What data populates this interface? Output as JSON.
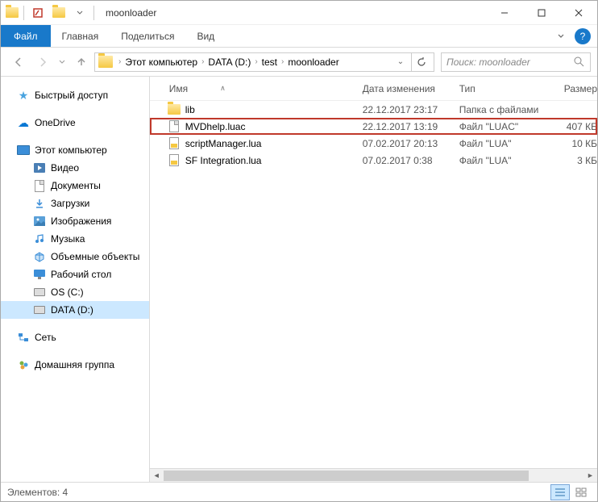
{
  "title": "moonloader",
  "ribbon": {
    "file": "Файл",
    "tabs": [
      "Главная",
      "Поделиться",
      "Вид"
    ]
  },
  "breadcrumb": [
    "Этот компьютер",
    "DATA (D:)",
    "test",
    "moonloader"
  ],
  "search": {
    "placeholder": "Поиск: moonloader"
  },
  "columns": {
    "name": "Имя",
    "date": "Дата изменения",
    "type": "Тип",
    "size": "Размер"
  },
  "sidebar": {
    "quick": "Быстрый доступ",
    "onedrive": "OneDrive",
    "thispc": "Этот компьютер",
    "video": "Видео",
    "documents": "Документы",
    "downloads": "Загрузки",
    "pictures": "Изображения",
    "music": "Музыка",
    "objects3d": "Объемные объекты",
    "desktop": "Рабочий стол",
    "osc": "OS (C:)",
    "datad": "DATA (D:)",
    "network": "Сеть",
    "homegroup": "Домашняя группа"
  },
  "files": [
    {
      "name": "lib",
      "date": "22.12.2017 23:17",
      "type": "Папка с файлами",
      "size": "",
      "icon": "folder",
      "highlighted": false
    },
    {
      "name": "MVDhelp.luac",
      "date": "22.12.2017 13:19",
      "type": "Файл \"LUAC\"",
      "size": "407 КБ",
      "icon": "doc",
      "highlighted": true
    },
    {
      "name": "scriptManager.lua",
      "date": "07.02.2017 20:13",
      "type": "Файл \"LUA\"",
      "size": "10 КБ",
      "icon": "lua",
      "highlighted": false
    },
    {
      "name": "SF Integration.lua",
      "date": "07.02.2017 0:38",
      "type": "Файл \"LUA\"",
      "size": "3 КБ",
      "icon": "lua",
      "highlighted": false
    }
  ],
  "status": {
    "items": "Элементов: 4"
  }
}
